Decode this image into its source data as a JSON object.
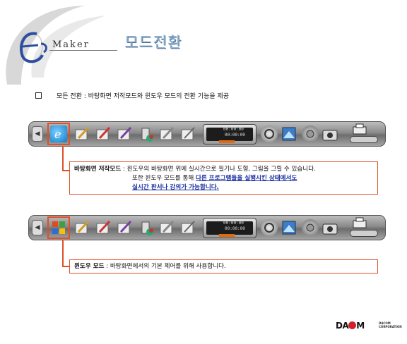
{
  "header": {
    "logo_word": "Maker",
    "title": "모드전환"
  },
  "bullet": {
    "text": "모든 전환 : 바탕화면 저작모드와 윈도우 모드의 전환 기능을 제공"
  },
  "toolbar": {
    "display_line1": "00:00:00",
    "display_line2": "00:00:00"
  },
  "callout_desktop": {
    "label": "바탕화면 저작모드",
    "line1": " : 윈도우의 바탕화면 위에 실시간으로 필기나 도형, 그림을 그릴 수 있습니다.",
    "line2_prefix": "또한 윈도우 모드를 통해 ",
    "line2_link": "다른 프로그램들을 실행시킨 상태에서도",
    "line3_link": "실시간 판서나 강의가 가능합니다."
  },
  "callout_window": {
    "label": "윈도우 모드",
    "text": " : 바탕화면에서의 기본 제어를 위해 사용합니다."
  },
  "footer": {
    "brand_left": "DA",
    "brand_right": "M",
    "sub1": "DACOM",
    "sub2": "CORPORATION"
  },
  "colors": {
    "accent_orange": "#e0502a",
    "link_blue": "#1a2fa0",
    "title_blue": "#8fb3d2"
  },
  "icons": [
    "e-maker-logo-icon",
    "windows-logo-icon",
    "pen-icon",
    "paint-bucket-icon",
    "gear-icon",
    "photo-icon",
    "camera-icon",
    "printer-icon"
  ]
}
